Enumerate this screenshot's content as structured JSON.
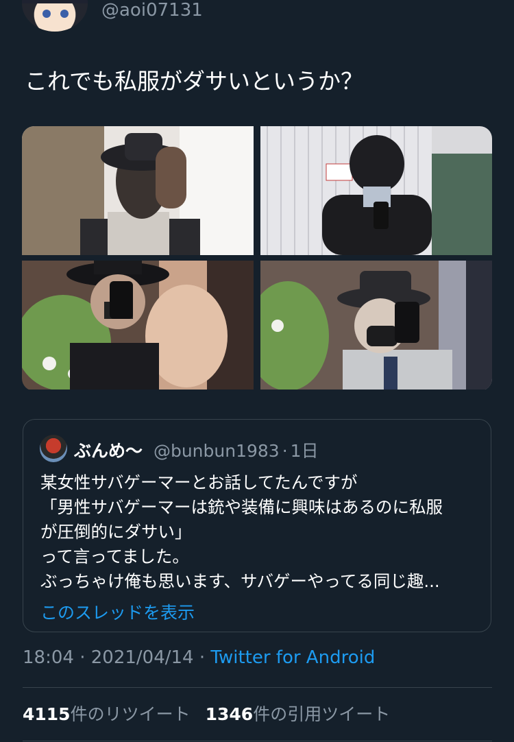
{
  "author": {
    "handle": "@aoi07131"
  },
  "tweet": {
    "text": "これでも私服がダサいというか？",
    "photos": [
      {
        "description_icon": "photo-1"
      },
      {
        "description_icon": "photo-2"
      },
      {
        "description_icon": "photo-3"
      },
      {
        "description_icon": "photo-4"
      }
    ],
    "time": "18:04",
    "date": "2021/04/14",
    "separator": "·",
    "source": "Twitter for Android"
  },
  "quote": {
    "name": "ぶんめ〜",
    "handle": "@bunbun1983",
    "age": "1日",
    "lines": [
      "某女性サバゲーマーとお話してたんですが",
      "「男性サバゲーマーは銃や装備に興味はあるのに私服",
      "が圧倒的にダサい」",
      "って言ってました。",
      "ぶっちゃけ俺も思います、サバゲーやってる同じ趣..."
    ],
    "show_thread": "このスレッドを表示"
  },
  "stats": {
    "retweets_count": "4115",
    "retweets_label": "件のリツイート",
    "quotes_count": "1346",
    "quotes_label": "件の引用ツイート"
  },
  "colors": {
    "background": "#15202b",
    "text": "#ffffff",
    "secondary": "#8b98a5",
    "accent": "#1d9bf0",
    "border": "#38444d"
  }
}
